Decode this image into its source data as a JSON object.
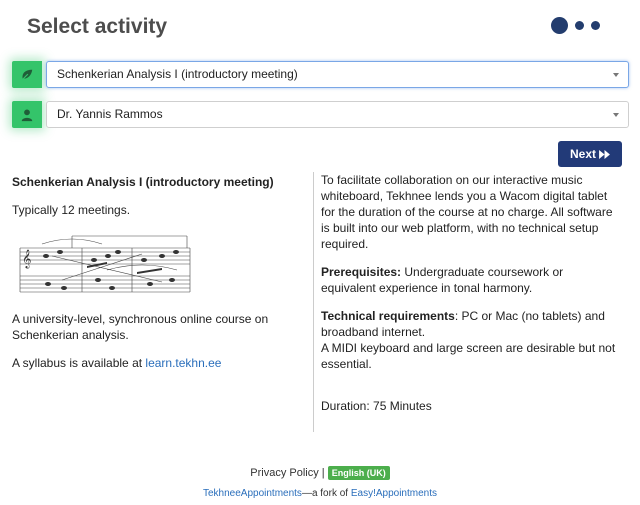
{
  "page": {
    "title": "Select activity"
  },
  "service_select": {
    "value": "Schenkerian Analysis I (introductory meeting)"
  },
  "provider_select": {
    "value": "Dr. Yannis Rammos"
  },
  "next_button": {
    "label": "Next"
  },
  "service_info": {
    "name": "Schenkerian Analysis I (introductory meeting)",
    "meetings": "Typically 12 meetings.",
    "description": "A university-level, synchronous online course on Schenkerian analysis.",
    "syllabus_prefix": "A syllabus is available at ",
    "syllabus_link": "learn.tekhn.ee"
  },
  "details": {
    "intro": "To facilitate collaboration on our interactive music whiteboard, Tekhnee lends you a Wacom digital tablet for the duration of the course at no charge. All software is built into our web platform, with no technical setup required.",
    "prereq_label": "Prerequisites:",
    "prereq_text": " Undergraduate coursework or equivalent experience in tonal harmony.",
    "tech_label": "Technical requirements",
    "tech_text": ": PC or Mac (no tablets) and broadband internet.",
    "tech_extra": "A MIDI keyboard and large screen are desirable but not essential.",
    "duration": "Duration: 75 Minutes"
  },
  "footer": {
    "privacy": "Privacy Policy",
    "separator": "|",
    "language": "English (UK)",
    "app_name": "TekhneeAppointments",
    "fork_text": "—a fork of ",
    "upstream": "Easy!Appointments"
  }
}
